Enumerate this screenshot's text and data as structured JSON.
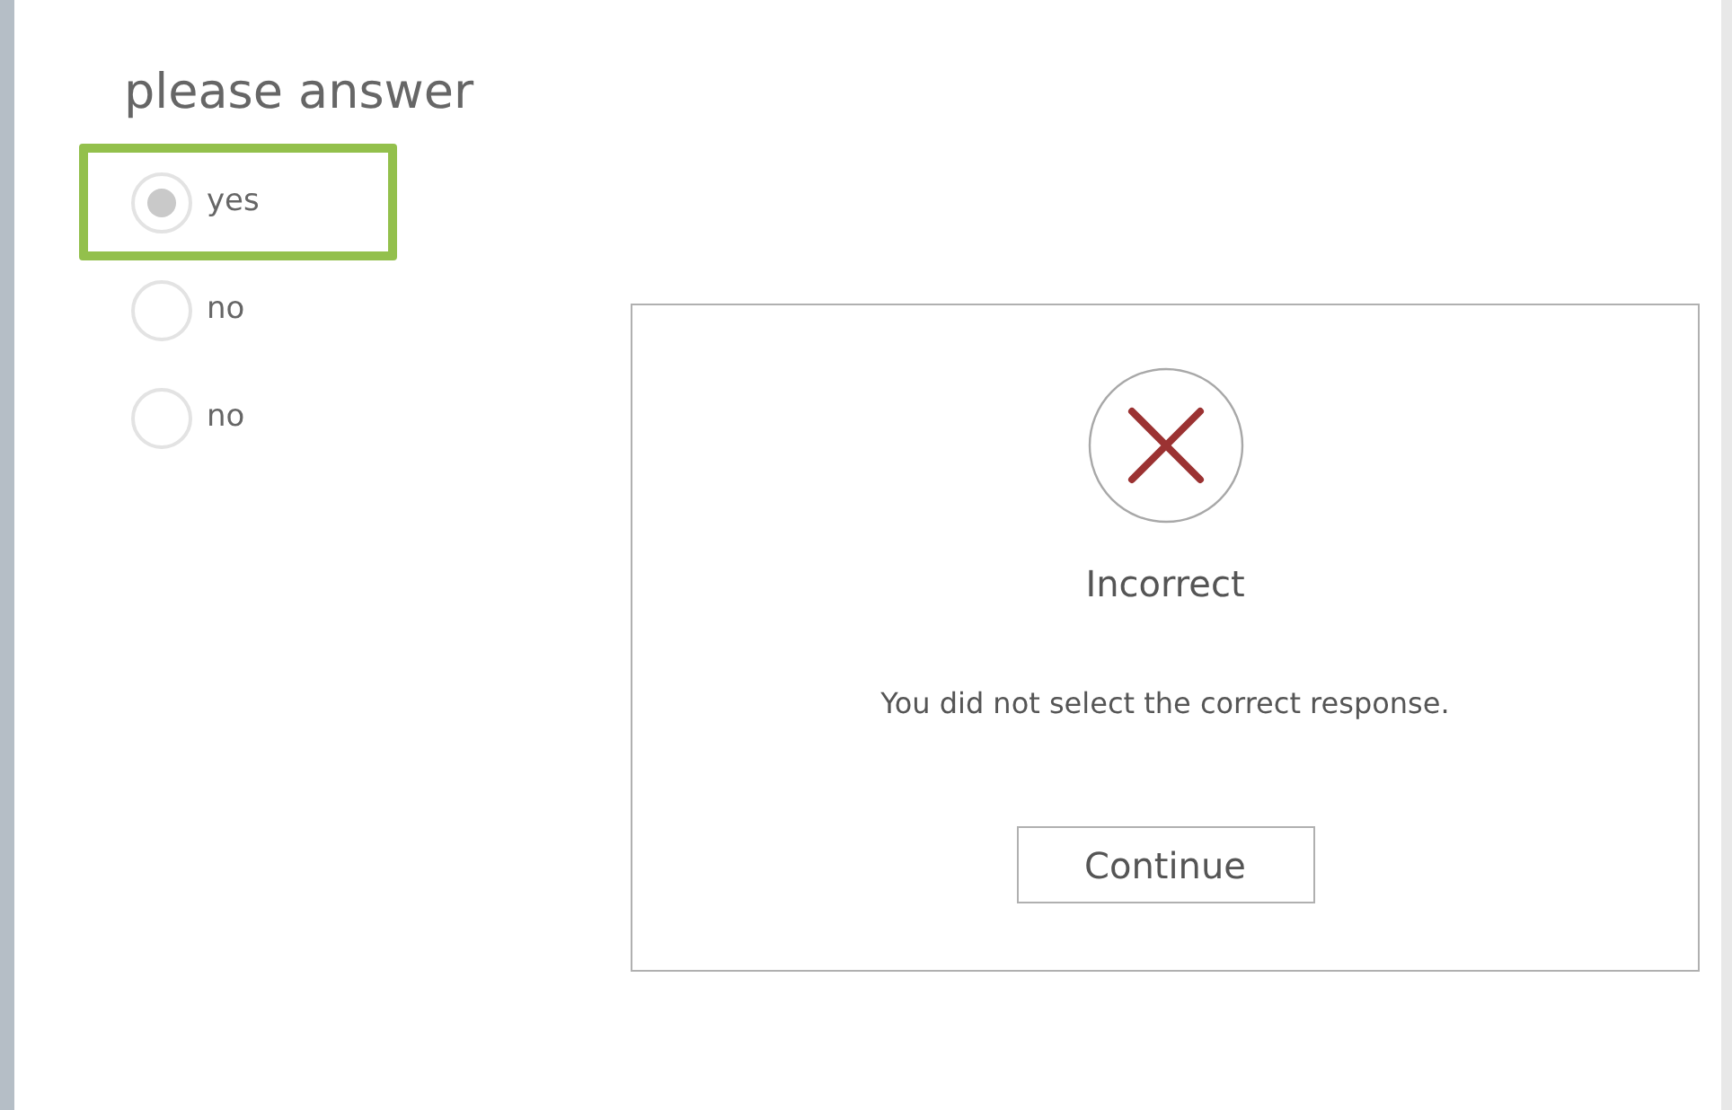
{
  "question": {
    "title": "please answer"
  },
  "options": [
    {
      "label": "yes",
      "selected": true
    },
    {
      "label": "no",
      "selected": false
    },
    {
      "label": "no",
      "selected": false
    }
  ],
  "feedback": {
    "kind": "incorrect",
    "title": "Incorrect",
    "message": "You did not select the correct response.",
    "button": "Continue"
  }
}
